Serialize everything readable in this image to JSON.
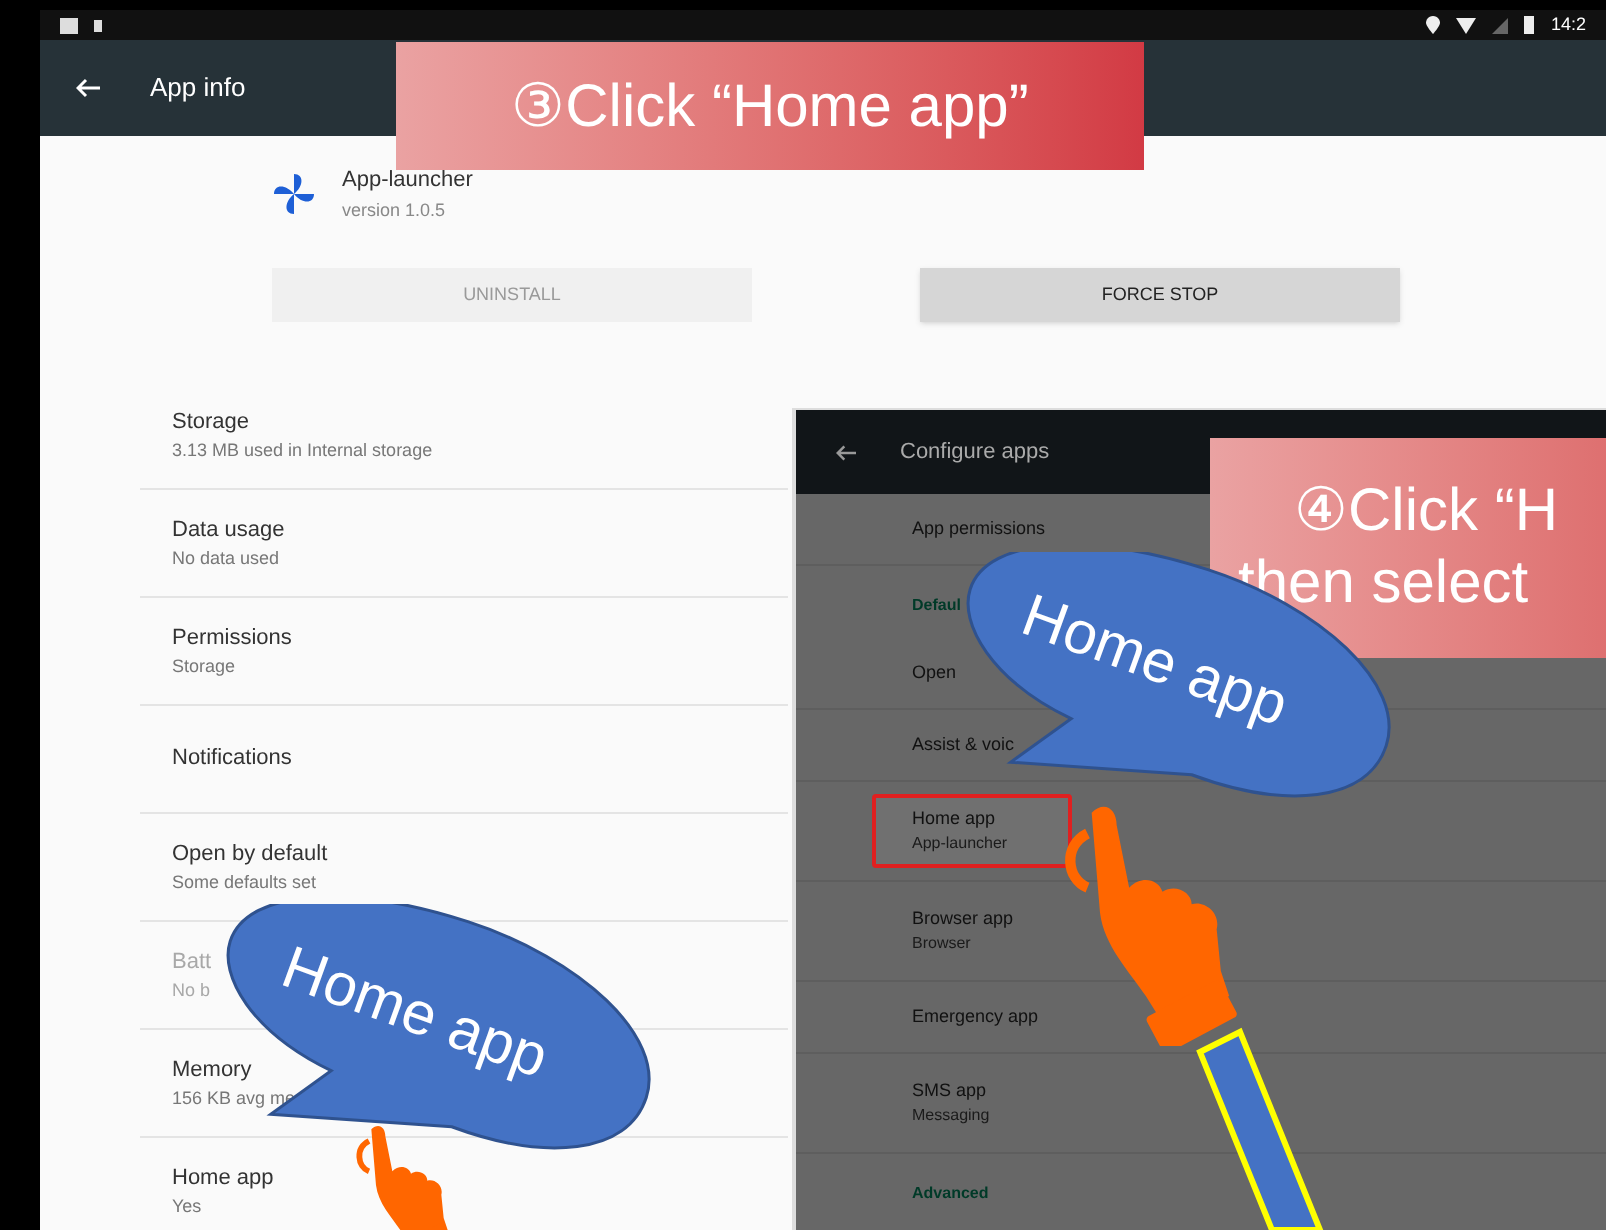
{
  "status_bar": {
    "time": "14:2"
  },
  "app_bar": {
    "title": "App info"
  },
  "app": {
    "name": "App-launcher",
    "version": "version 1.0.5"
  },
  "buttons": [
    {
      "label": "UNINSTALL",
      "disabled": true
    },
    {
      "label": "FORCE STOP",
      "disabled": false
    }
  ],
  "settings": [
    {
      "title": "Storage",
      "summary": "3.13 MB used in Internal storage",
      "disabled": false
    },
    {
      "title": "Data usage",
      "summary": "No data used",
      "disabled": false
    },
    {
      "title": "Permissions",
      "summary": "Storage",
      "disabled": false
    },
    {
      "title": "Notifications",
      "disabled": false
    },
    {
      "title": "Open by default",
      "summary": "Some defaults set",
      "disabled": false
    },
    {
      "title": "Batt",
      "summary": "No b",
      "disabled": true
    },
    {
      "title": "Memory",
      "summary": "156 KB avg me",
      "disabled": false
    },
    {
      "title": "Home app",
      "summary": "Yes",
      "disabled": false
    }
  ],
  "inset": {
    "title": "Configure apps",
    "items": [
      {
        "kind": "item",
        "title": "App permissions",
        "highlighted": false
      },
      {
        "kind": "header",
        "title": "Defaul",
        "highlighted": false
      },
      {
        "kind": "item",
        "title": "Open",
        "highlighted": false
      },
      {
        "kind": "item",
        "title": "Assist & voic",
        "highlighted": false
      },
      {
        "kind": "item",
        "title": "Home app",
        "summary": "App-launcher",
        "highlighted": true
      },
      {
        "kind": "item",
        "title": "Browser app",
        "summary": "Browser",
        "highlighted": false
      },
      {
        "kind": "item",
        "title": "Emergency app",
        "highlighted": false
      },
      {
        "kind": "item",
        "title": "SMS app",
        "summary": "Messaging",
        "highlighted": false
      },
      {
        "kind": "header",
        "title": "Advanced",
        "highlighted": false
      }
    ]
  },
  "annotations": {
    "step3": "③Click “Home app”",
    "step4": [
      "④Click “H",
      "then select"
    ],
    "bubbles": [
      "Home app",
      "Home app"
    ]
  }
}
